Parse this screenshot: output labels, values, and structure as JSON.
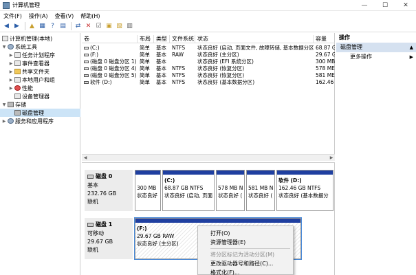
{
  "window": {
    "title": "计算机管理",
    "minimize": "—",
    "maximize": "☐",
    "close": "✕"
  },
  "menu": [
    "文件(F)",
    "操作(A)",
    "查看(V)",
    "帮助(H)"
  ],
  "toolbar_icons": [
    "back-icon",
    "forward-icon",
    "up-folder-icon",
    "show-tree-icon",
    "help-icon",
    "properties-icon",
    "connect-icon",
    "delete-icon",
    "checklist-icon",
    "folder-search-icon",
    "export-icon",
    "view-icon"
  ],
  "tree": [
    {
      "label": "计算机管理(本地)",
      "icon": "computer-icon",
      "toggle": "",
      "indent": 0
    },
    {
      "label": "系统工具",
      "icon": "tools-icon",
      "toggle": "▼",
      "indent": 1
    },
    {
      "label": "任务计划程序",
      "icon": "clock-icon",
      "toggle": "▶",
      "indent": 2
    },
    {
      "label": "事件查看器",
      "icon": "event-icon",
      "toggle": "▶",
      "indent": 2
    },
    {
      "label": "共享文件夹",
      "icon": "folder-icon",
      "toggle": "▶",
      "indent": 2
    },
    {
      "label": "本地用户和组",
      "icon": "users-icon",
      "toggle": "▶",
      "indent": 2
    },
    {
      "label": "性能",
      "icon": "performance-icon",
      "toggle": "▶",
      "indent": 2
    },
    {
      "label": "设备管理器",
      "icon": "device-icon",
      "toggle": "",
      "indent": 2
    },
    {
      "label": "存储",
      "icon": "storage-icon",
      "toggle": "▼",
      "indent": 1
    },
    {
      "label": "磁盘管理",
      "icon": "disk-icon",
      "toggle": "",
      "indent": 2
    },
    {
      "label": "服务和应用程序",
      "icon": "services-icon",
      "toggle": "▶",
      "indent": 1
    }
  ],
  "list": {
    "columns": [
      "卷",
      "布局",
      "类型",
      "文件系统",
      "状态",
      "容量"
    ],
    "rows": [
      [
        "(C:)",
        "简单",
        "基本",
        "NTFS",
        "状态良好 (启动, 页面文件, 故障转储, 基本数据分区)",
        "68.87 G"
      ],
      [
        "(F:)",
        "简单",
        "基本",
        "RAW",
        "状态良好 (主分区)",
        "29.67 G"
      ],
      [
        "(磁盘 0 磁盘分区 1)",
        "简单",
        "基本",
        "",
        "状态良好 (EFI 系统分区)",
        "300 MB"
      ],
      [
        "(磁盘 0 磁盘分区 4)",
        "简单",
        "基本",
        "NTFS",
        "状态良好 (恢复分区)",
        "578 ME"
      ],
      [
        "(磁盘 0 磁盘分区 5)",
        "简单",
        "基本",
        "NTFS",
        "状态良好 (恢复分区)",
        "581 ME"
      ],
      [
        "软件 (D:)",
        "简单",
        "基本",
        "NTFS",
        "状态良好 (基本数据分区)",
        "162.46"
      ]
    ]
  },
  "disks": [
    {
      "name": "磁盘 0",
      "lines": [
        "基本",
        "232.76 GB",
        "联机"
      ],
      "partitions": [
        {
          "name": "",
          "lines": [
            "300 MB",
            "状态良好"
          ]
        },
        {
          "name": "(C:)",
          "lines": [
            "68.87 GB NTFS",
            "状态良好 (启动, 页面"
          ]
        },
        {
          "name": "",
          "lines": [
            "578 MB N",
            "状态良好 ("
          ]
        },
        {
          "name": "",
          "lines": [
            "581 MB N",
            "状态良好 ("
          ]
        },
        {
          "name": "软件 (D:)",
          "lines": [
            "162.46 GB NTFS",
            "状态良好 (基本数据分"
          ]
        }
      ]
    },
    {
      "name": "磁盘 1",
      "lines": [
        "可移动",
        "29.67 GB",
        "联机"
      ],
      "partitions": [
        {
          "name": "(F:)",
          "lines": [
            "29.67 GB RAW",
            "状态良好 (主分区)"
          ]
        }
      ]
    }
  ],
  "actions": {
    "header": "操作",
    "selected": "磁盘管理",
    "more": "更多操作"
  },
  "context_menu": [
    {
      "label": "打开(O)",
      "disabled": false
    },
    {
      "label": "资源管理器(E)",
      "disabled": false
    },
    {
      "sep": true
    },
    {
      "label": "将分区标记为活动分区(M)",
      "disabled": true
    },
    {
      "label": "更改驱动器号和路径(C)...",
      "disabled": false
    },
    {
      "label": "格式化(F)...",
      "disabled": false
    }
  ]
}
